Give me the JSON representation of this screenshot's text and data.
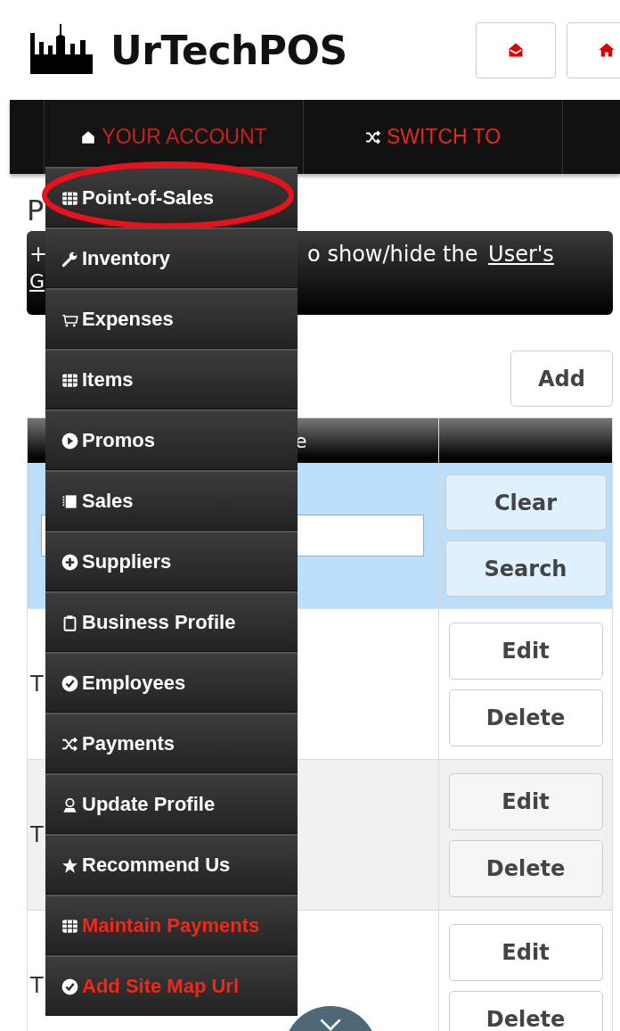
{
  "header": {
    "brand": "UrTechPOS",
    "icon_buttons": [
      {
        "kind": "mail"
      },
      {
        "kind": "home"
      }
    ]
  },
  "navbar": {
    "items": [
      {
        "label": "YOUR ACCOUNT",
        "expanded": true
      },
      {
        "label": "SWITCH TO",
        "expanded": false
      }
    ]
  },
  "dropdown": {
    "items": [
      {
        "label": "Point-of-Sales",
        "kind": "normal",
        "circled": true
      },
      {
        "label": "Inventory",
        "kind": "normal",
        "circled": false
      },
      {
        "label": "Expenses",
        "kind": "normal",
        "circled": false
      },
      {
        "label": "Items",
        "kind": "normal",
        "circled": false
      },
      {
        "label": "Promos",
        "kind": "normal",
        "circled": false
      },
      {
        "label": "Sales",
        "kind": "normal",
        "circled": false
      },
      {
        "label": "Suppliers",
        "kind": "normal",
        "circled": false
      },
      {
        "label": "Business Profile",
        "kind": "normal",
        "circled": false
      },
      {
        "label": "Employees",
        "kind": "normal",
        "circled": false
      },
      {
        "label": "Payments",
        "kind": "normal",
        "circled": false
      },
      {
        "label": "Update Profile",
        "kind": "normal",
        "circled": false
      },
      {
        "label": "Recommend Us",
        "kind": "normal",
        "circled": false
      },
      {
        "label": "Maintain Payments",
        "kind": "highlighted",
        "circled": false
      },
      {
        "label": "Add Site Map Url",
        "kind": "highlighted",
        "circled": false
      }
    ]
  },
  "page": {
    "title": "P",
    "info_bar": {
      "toggle": "+",
      "text": "o show/hide the ",
      "link": "User's",
      "link_2": "G"
    },
    "add_button": "Add",
    "table": {
      "columns": [
        "e"
      ],
      "filter_row": {
        "buttons": [
          "Clear",
          "Search"
        ]
      },
      "rows": [
        {
          "column_1": "T",
          "actions": [
            "Edit",
            "Delete"
          ]
        },
        {
          "column_1": "T",
          "actions": [
            "Edit",
            "Delete"
          ]
        },
        {
          "column_1": "T",
          "actions": [
            "Edit",
            "Delete"
          ]
        }
      ]
    }
  }
}
